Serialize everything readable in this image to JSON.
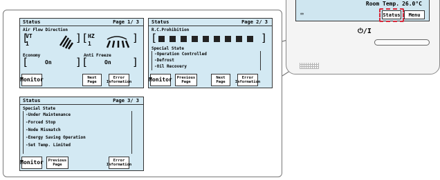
{
  "screen1": {
    "title": "Status",
    "page": "Page 1/ 3",
    "air_flow_label": "Air Flow Direction",
    "vt_label": "VT",
    "vt_value": "1",
    "hz_label": "HZ",
    "hz_value": "1",
    "economy_label": "Economy",
    "economy_value": "On",
    "anti_freeze_label": "Anti Freeze",
    "anti_freeze_value": "On",
    "buttons": {
      "monitor": "Monitor",
      "next": "Next Page",
      "error": "Error Information"
    }
  },
  "screen2": {
    "title": "Status",
    "page": "Page 2/ 3",
    "rc_label": "R.C.Prohibition",
    "special_label": "Special State",
    "items": [
      "-Operation Controlled",
      "-Defrost",
      "-Oil Recovery"
    ],
    "buttons": {
      "monitor": "Monitor",
      "prev": "Previous Page",
      "next": "Next Page",
      "error": "Error Information"
    }
  },
  "screen3": {
    "title": "Status",
    "page": "Page 3/ 3",
    "special_label": "Special State",
    "items": [
      "-Under Maintenance",
      "-Forced Stop",
      "-Node Mismatch",
      "-Energy Saving Operation",
      "-Set Temp. Limited"
    ],
    "buttons": {
      "monitor": "Monitor",
      "prev": "Previous Page",
      "error": "Error Information"
    }
  },
  "remote": {
    "room_temp_label": "Room Temp.",
    "room_temp_value": "26.0°C",
    "status_button": "Status",
    "menu_button": "Menu",
    "power_label": "ON/OFF"
  },
  "colors": {
    "lcd_background": "#d3e9f3",
    "highlight": "#d8283a"
  }
}
